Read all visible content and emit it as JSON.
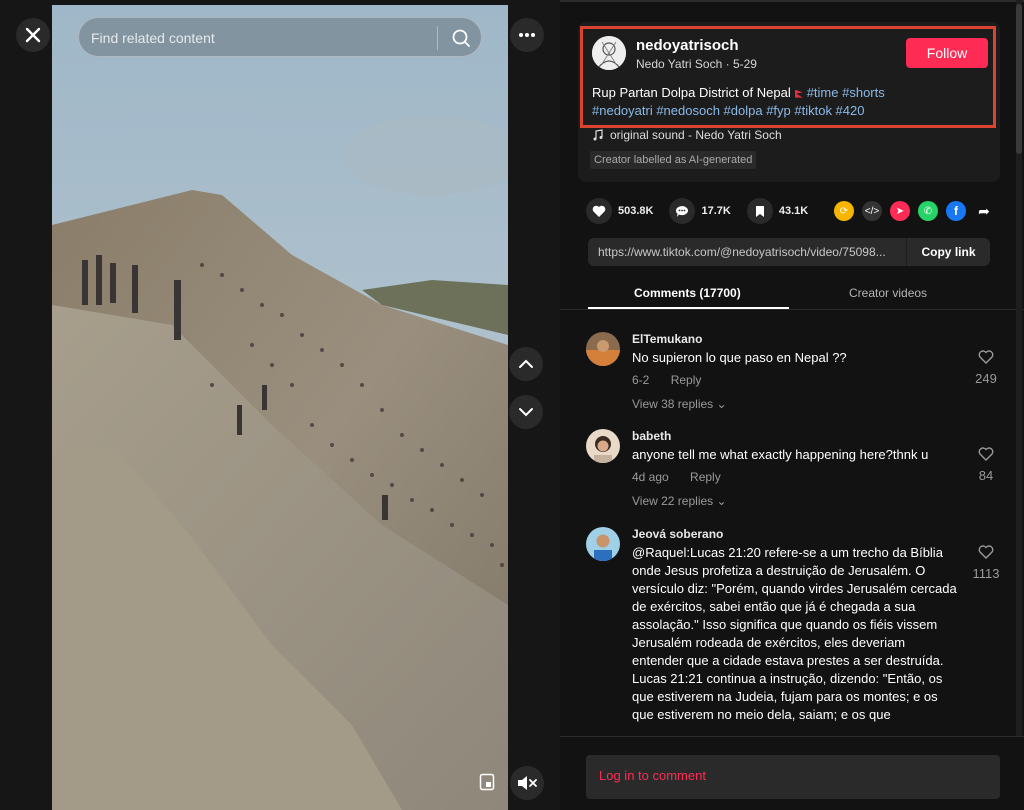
{
  "search": {
    "placeholder": "Find related content"
  },
  "post": {
    "username": "nedoyatrisoch",
    "display_name": "Nedo Yatri Soch",
    "date": "5-29",
    "follow_label": "Follow",
    "description_text": "Rup Partan Dolpa District of Nepal",
    "hashtags_line1": "#time #shorts",
    "hashtags_line2": "#nedoyatri #nedosoch #dolpa #fyp #tiktok #420",
    "sound": "original sound - Nedo Yatri Soch",
    "ai_label": "Creator labelled as AI-generated"
  },
  "stats": {
    "likes": "503.8K",
    "comments": "17.7K",
    "saves": "43.1K"
  },
  "share_icons": [
    "repost-icon",
    "embed-icon",
    "send-icon",
    "whatsapp-icon",
    "facebook-icon",
    "share-arrow-icon"
  ],
  "link": {
    "url": "https://www.tiktok.com/@nedoyatrisoch/video/75098...",
    "copy_label": "Copy link"
  },
  "tabs": {
    "comments": "Comments (17700)",
    "creator": "Creator videos"
  },
  "comments": [
    {
      "name": "ElTemukano",
      "text": "No supieron lo que paso en Nepal ??",
      "date": "6-2",
      "reply": "Reply",
      "replies": "View 38 replies",
      "likes": "249"
    },
    {
      "name": "babeth",
      "text": "anyone tell me what exactly happening here?thnk u",
      "date": "4d ago",
      "reply": "Reply",
      "replies": "View 22 replies",
      "likes": "84"
    },
    {
      "name": "Jeová soberano",
      "text": "@Raquel:Lucas 21:20 refere-se a um trecho da Bíblia onde Jesus profetiza a destruição de Jerusalém. O versículo diz: \"Porém, quando virdes Jerusalém cercada de exércitos, sabei então que já é chegada a sua assolação.\" Isso significa que quando os fiéis vissem Jerusalém rodeada de exércitos, eles deveriam entender que a cidade estava prestes a ser destruída. Lucas 21:21 continua a instrução, dizendo: \"Então, os que estiverem na Judeia, fujam para os montes; e os que estiverem no meio dela, saiam; e os que",
      "likes": "1113"
    }
  ],
  "footer": {
    "login": "Log in to comment"
  },
  "colors": {
    "brand": "#fe2c55",
    "highlight": "#d9432f",
    "hashtag": "#8ab9e8"
  }
}
